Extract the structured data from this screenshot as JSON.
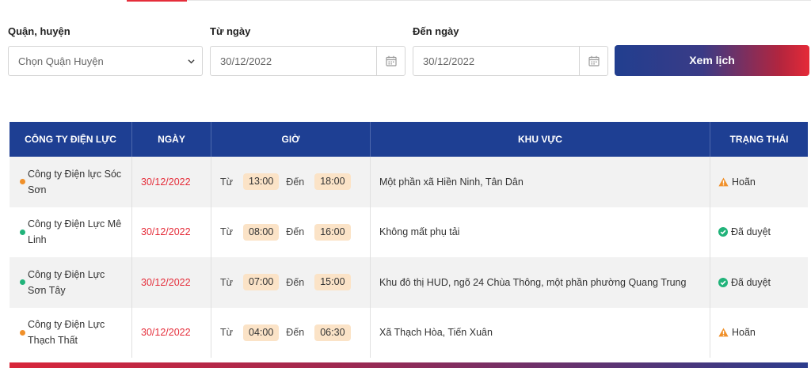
{
  "filters": {
    "district_label": "Quận, huyện",
    "district_value": "Chọn Quận Huyện",
    "from_label": "Từ ngày",
    "from_value": "30/12/2022",
    "to_label": "Đến ngày",
    "to_value": "30/12/2022",
    "submit_label": "Xem lịch"
  },
  "table": {
    "headers": [
      "CÔNG TY ĐIỆN LỰC",
      "NGÀY",
      "GIỜ",
      "KHU VỰC",
      "TRẠNG THÁI"
    ],
    "from_word": "Từ",
    "to_word": "Đến",
    "rows": [
      {
        "company_line1": "Công ty Điện lực Sóc",
        "company_line2": "Sơn",
        "date": "30/12/2022",
        "start": "13:00",
        "end": "18:00",
        "area": "Một phần xã Hiền Ninh, Tân Dân",
        "status": "Hoãn",
        "status_icon": "warning-icon",
        "dot_color": "#f0902a"
      },
      {
        "company_line1": "Công ty Điện Lực Mê",
        "company_line2": "Linh",
        "date": "30/12/2022",
        "start": "08:00",
        "end": "16:00",
        "area": "Không mất phụ tải",
        "status": "Đã duyệt",
        "status_icon": "check-circle-icon",
        "dot_color": "#21b37a"
      },
      {
        "company_line1": "Công ty Điện Lực",
        "company_line2": "Sơn Tây",
        "date": "30/12/2022",
        "start": "07:00",
        "end": "15:00",
        "area": "Khu đô thị HUD, ngõ 24 Chùa Thông, một phần phường Quang Trung",
        "status": "Đã duyệt",
        "status_icon": "check-circle-icon",
        "dot_color": "#21b37a"
      },
      {
        "company_line1": "Công ty Điện Lực",
        "company_line2": "Thạch Thất",
        "date": "30/12/2022",
        "start": "04:00",
        "end": "06:30",
        "area": "Xã Thạch Hòa, Tiến Xuân",
        "status": "Hoãn",
        "status_icon": "warning-icon",
        "dot_color": "#f0902a"
      }
    ]
  },
  "colors": {
    "header_blue": "#1e3f93",
    "date_red": "#e52d3a",
    "pill_bg": "#fbe3c7",
    "approved_green": "#21b37a",
    "postponed_orange": "#f0902a"
  }
}
